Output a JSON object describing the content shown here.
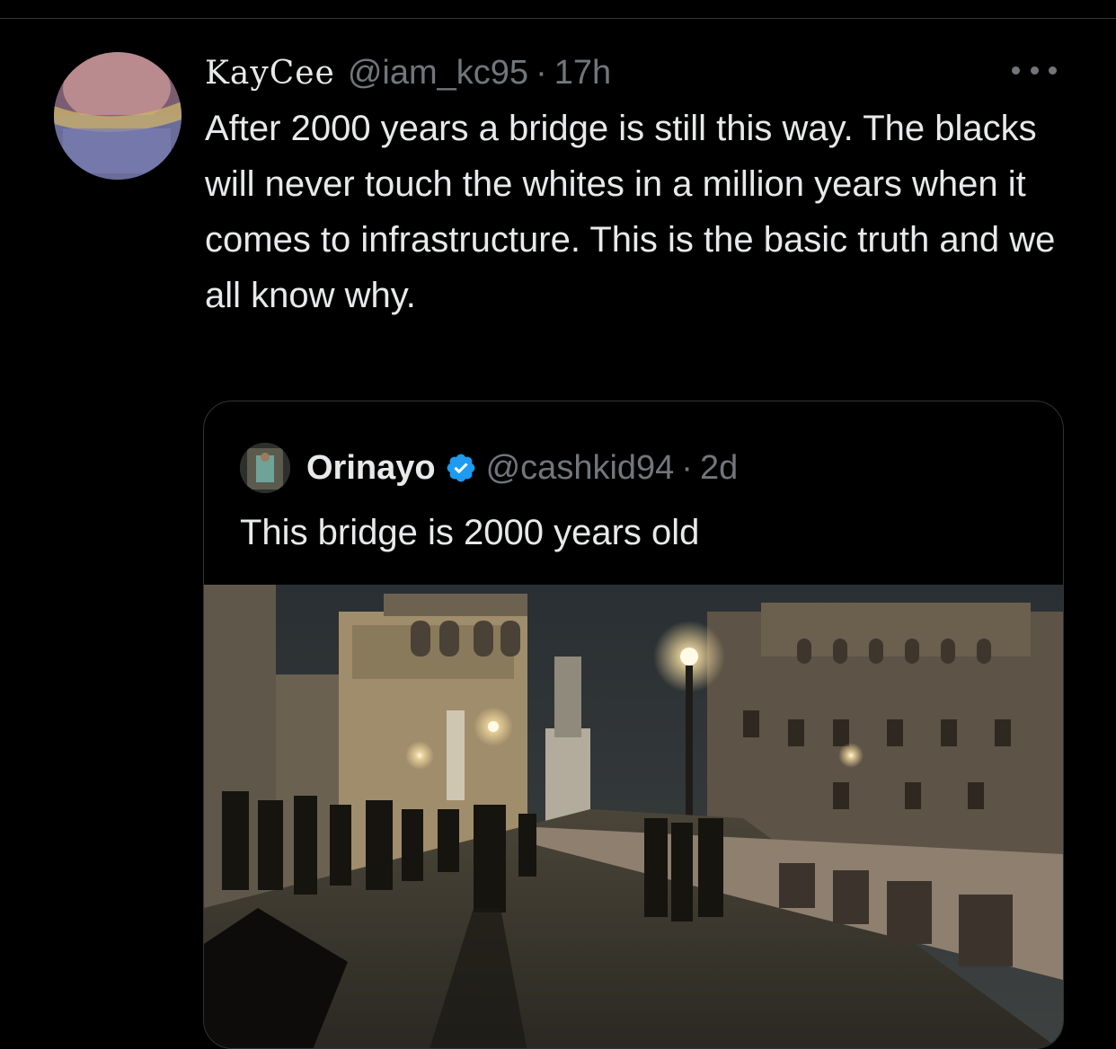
{
  "tweet": {
    "author_name": "KayCee",
    "author_handle": "@iam_kc95",
    "separator": "·",
    "timestamp": "17h",
    "text": "After 2000 years a bridge is still this way. The blacks will never touch the whites in a million years when it comes to infrastructure. This is the basic truth and we all know why.",
    "more_icon": "more-horizontal-icon"
  },
  "quoted_tweet": {
    "author_name": "Orinayo",
    "author_handle": "@cashkid94",
    "separator": "·",
    "timestamp": "2d",
    "verified_icon": "verified-badge-icon",
    "text": "This bridge is 2000 years old",
    "media": "night-bridge-photo"
  },
  "colors": {
    "background": "#000000",
    "text": "#e7e9ea",
    "muted": "#71767b",
    "border": "#2f3336",
    "verified": "#1d9bf0"
  }
}
